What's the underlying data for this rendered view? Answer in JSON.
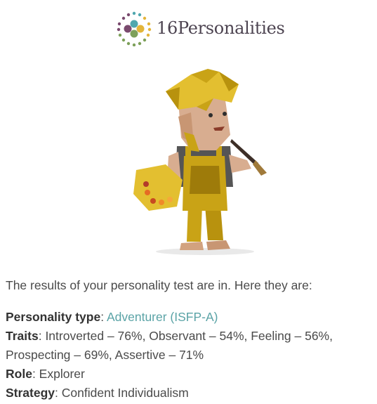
{
  "brand": {
    "name": "16Personalities",
    "logo_icon": "dots-circle-logo"
  },
  "hero": {
    "icon": "adventurer-painter-illustration"
  },
  "message": {
    "intro": "The results of your personality test are in. Here they are:"
  },
  "results": {
    "type_label": "Personality type",
    "type_value": "Adventurer (ISFP-A)",
    "traits_label": "Traits",
    "traits_value": "Introverted – 76%, Observant – 54%, Feeling – 56%, Prospecting – 69%, Assertive – 71%",
    "role_label": "Role",
    "role_value": "Explorer",
    "strategy_label": "Strategy",
    "strategy_value": "Confident Individualism"
  },
  "colors": {
    "link": "#5aa3a6",
    "brand_text": "#4d4451",
    "body_text": "#4a4a4a"
  }
}
